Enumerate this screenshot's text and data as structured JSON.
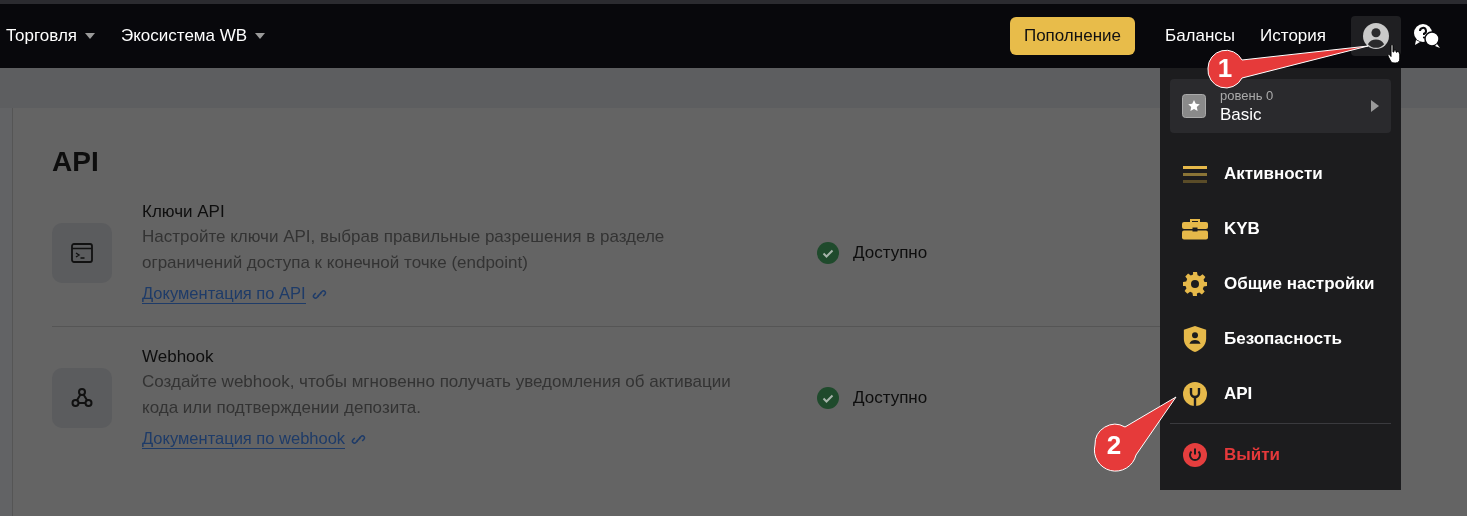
{
  "top_nav": {
    "menus": [
      {
        "label": "Торговля"
      },
      {
        "label": "Экосистема WB"
      }
    ],
    "topup_button": "Пополнение",
    "links": [
      "Балансы",
      "История"
    ]
  },
  "page": {
    "title": "API",
    "items": [
      {
        "kind": "terminal",
        "title": "Ключи API",
        "description": "Настройте ключи API, выбрав правильные разрешения в разделе ограничений доступа к конечной точке (endpoint)",
        "link": "Документация по API",
        "status": "Доступно"
      },
      {
        "kind": "webhook",
        "title": "Webhook",
        "description": "Создайте webhook, чтобы мгновенно получать уведомления об активации кода или подтверждении депозита.",
        "link": "Документация по webhook",
        "status": "Доступно"
      }
    ]
  },
  "account_menu": {
    "level_label": "ровень 0",
    "level_name": "Basic",
    "items": [
      {
        "kind": "activities",
        "label": "Активности"
      },
      {
        "kind": "kyb",
        "label": "KYB"
      },
      {
        "kind": "settings",
        "label": "Общие настройки"
      },
      {
        "kind": "security",
        "label": "Безопасность"
      },
      {
        "kind": "api",
        "label": "API"
      },
      {
        "kind": "logout",
        "label": "Выйти"
      }
    ]
  },
  "callouts": [
    {
      "number": "1"
    },
    {
      "number": "2"
    }
  ]
}
